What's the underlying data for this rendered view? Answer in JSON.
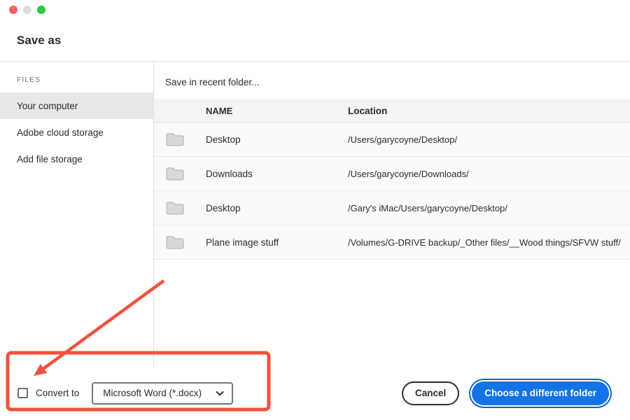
{
  "window": {
    "title": "Save as"
  },
  "sidebar": {
    "section_label": "FILES",
    "items": [
      {
        "label": "Your computer",
        "selected": true
      },
      {
        "label": "Adobe cloud storage",
        "selected": false
      },
      {
        "label": "Add file storage",
        "selected": false
      }
    ]
  },
  "content": {
    "hint": "Save in recent folder...",
    "table": {
      "columns": {
        "name": "NAME",
        "location": "Location"
      },
      "rows": [
        {
          "name": "Desktop",
          "location": "/Users/garycoyne/Desktop/"
        },
        {
          "name": "Downloads",
          "location": "/Users/garycoyne/Downloads/"
        },
        {
          "name": "Desktop",
          "location": "/Gary's iMac/Users/garycoyne/Desktop/"
        },
        {
          "name": "Plane image stuff",
          "location": "/Volumes/G-DRIVE backup/_Other files/__Wood things/SFVW stuff/"
        }
      ]
    }
  },
  "footer": {
    "convert_label": "Convert to",
    "convert_checked": false,
    "format_dropdown": "Microsoft Word (*.docx)",
    "cancel_label": "Cancel",
    "primary_label": "Choose a different folder"
  },
  "colors": {
    "primary_blue": "#1473E6",
    "primary_blue_dark": "#0D62C9",
    "annotation_red": "#F1513D"
  }
}
